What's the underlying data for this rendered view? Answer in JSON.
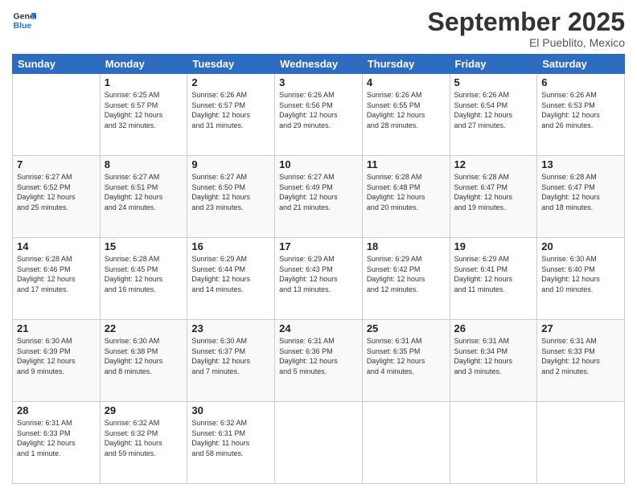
{
  "header": {
    "logo_line1": "General",
    "logo_line2": "Blue",
    "month": "September 2025",
    "location": "El Pueblito, Mexico"
  },
  "weekdays": [
    "Sunday",
    "Monday",
    "Tuesday",
    "Wednesday",
    "Thursday",
    "Friday",
    "Saturday"
  ],
  "weeks": [
    [
      {
        "day": "",
        "info": ""
      },
      {
        "day": "1",
        "info": "Sunrise: 6:25 AM\nSunset: 6:57 PM\nDaylight: 12 hours\nand 32 minutes."
      },
      {
        "day": "2",
        "info": "Sunrise: 6:26 AM\nSunset: 6:57 PM\nDaylight: 12 hours\nand 31 minutes."
      },
      {
        "day": "3",
        "info": "Sunrise: 6:26 AM\nSunset: 6:56 PM\nDaylight: 12 hours\nand 29 minutes."
      },
      {
        "day": "4",
        "info": "Sunrise: 6:26 AM\nSunset: 6:55 PM\nDaylight: 12 hours\nand 28 minutes."
      },
      {
        "day": "5",
        "info": "Sunrise: 6:26 AM\nSunset: 6:54 PM\nDaylight: 12 hours\nand 27 minutes."
      },
      {
        "day": "6",
        "info": "Sunrise: 6:26 AM\nSunset: 6:53 PM\nDaylight: 12 hours\nand 26 minutes."
      }
    ],
    [
      {
        "day": "7",
        "info": "Sunrise: 6:27 AM\nSunset: 6:52 PM\nDaylight: 12 hours\nand 25 minutes."
      },
      {
        "day": "8",
        "info": "Sunrise: 6:27 AM\nSunset: 6:51 PM\nDaylight: 12 hours\nand 24 minutes."
      },
      {
        "day": "9",
        "info": "Sunrise: 6:27 AM\nSunset: 6:50 PM\nDaylight: 12 hours\nand 23 minutes."
      },
      {
        "day": "10",
        "info": "Sunrise: 6:27 AM\nSunset: 6:49 PM\nDaylight: 12 hours\nand 21 minutes."
      },
      {
        "day": "11",
        "info": "Sunrise: 6:28 AM\nSunset: 6:48 PM\nDaylight: 12 hours\nand 20 minutes."
      },
      {
        "day": "12",
        "info": "Sunrise: 6:28 AM\nSunset: 6:47 PM\nDaylight: 12 hours\nand 19 minutes."
      },
      {
        "day": "13",
        "info": "Sunrise: 6:28 AM\nSunset: 6:47 PM\nDaylight: 12 hours\nand 18 minutes."
      }
    ],
    [
      {
        "day": "14",
        "info": "Sunrise: 6:28 AM\nSunset: 6:46 PM\nDaylight: 12 hours\nand 17 minutes."
      },
      {
        "day": "15",
        "info": "Sunrise: 6:28 AM\nSunset: 6:45 PM\nDaylight: 12 hours\nand 16 minutes."
      },
      {
        "day": "16",
        "info": "Sunrise: 6:29 AM\nSunset: 6:44 PM\nDaylight: 12 hours\nand 14 minutes."
      },
      {
        "day": "17",
        "info": "Sunrise: 6:29 AM\nSunset: 6:43 PM\nDaylight: 12 hours\nand 13 minutes."
      },
      {
        "day": "18",
        "info": "Sunrise: 6:29 AM\nSunset: 6:42 PM\nDaylight: 12 hours\nand 12 minutes."
      },
      {
        "day": "19",
        "info": "Sunrise: 6:29 AM\nSunset: 6:41 PM\nDaylight: 12 hours\nand 11 minutes."
      },
      {
        "day": "20",
        "info": "Sunrise: 6:30 AM\nSunset: 6:40 PM\nDaylight: 12 hours\nand 10 minutes."
      }
    ],
    [
      {
        "day": "21",
        "info": "Sunrise: 6:30 AM\nSunset: 6:39 PM\nDaylight: 12 hours\nand 9 minutes."
      },
      {
        "day": "22",
        "info": "Sunrise: 6:30 AM\nSunset: 6:38 PM\nDaylight: 12 hours\nand 8 minutes."
      },
      {
        "day": "23",
        "info": "Sunrise: 6:30 AM\nSunset: 6:37 PM\nDaylight: 12 hours\nand 7 minutes."
      },
      {
        "day": "24",
        "info": "Sunrise: 6:31 AM\nSunset: 6:36 PM\nDaylight: 12 hours\nand 5 minutes."
      },
      {
        "day": "25",
        "info": "Sunrise: 6:31 AM\nSunset: 6:35 PM\nDaylight: 12 hours\nand 4 minutes."
      },
      {
        "day": "26",
        "info": "Sunrise: 6:31 AM\nSunset: 6:34 PM\nDaylight: 12 hours\nand 3 minutes."
      },
      {
        "day": "27",
        "info": "Sunrise: 6:31 AM\nSunset: 6:33 PM\nDaylight: 12 hours\nand 2 minutes."
      }
    ],
    [
      {
        "day": "28",
        "info": "Sunrise: 6:31 AM\nSunset: 6:33 PM\nDaylight: 12 hours\nand 1 minute."
      },
      {
        "day": "29",
        "info": "Sunrise: 6:32 AM\nSunset: 6:32 PM\nDaylight: 11 hours\nand 59 minutes."
      },
      {
        "day": "30",
        "info": "Sunrise: 6:32 AM\nSunset: 6:31 PM\nDaylight: 11 hours\nand 58 minutes."
      },
      {
        "day": "",
        "info": ""
      },
      {
        "day": "",
        "info": ""
      },
      {
        "day": "",
        "info": ""
      },
      {
        "day": "",
        "info": ""
      }
    ]
  ]
}
